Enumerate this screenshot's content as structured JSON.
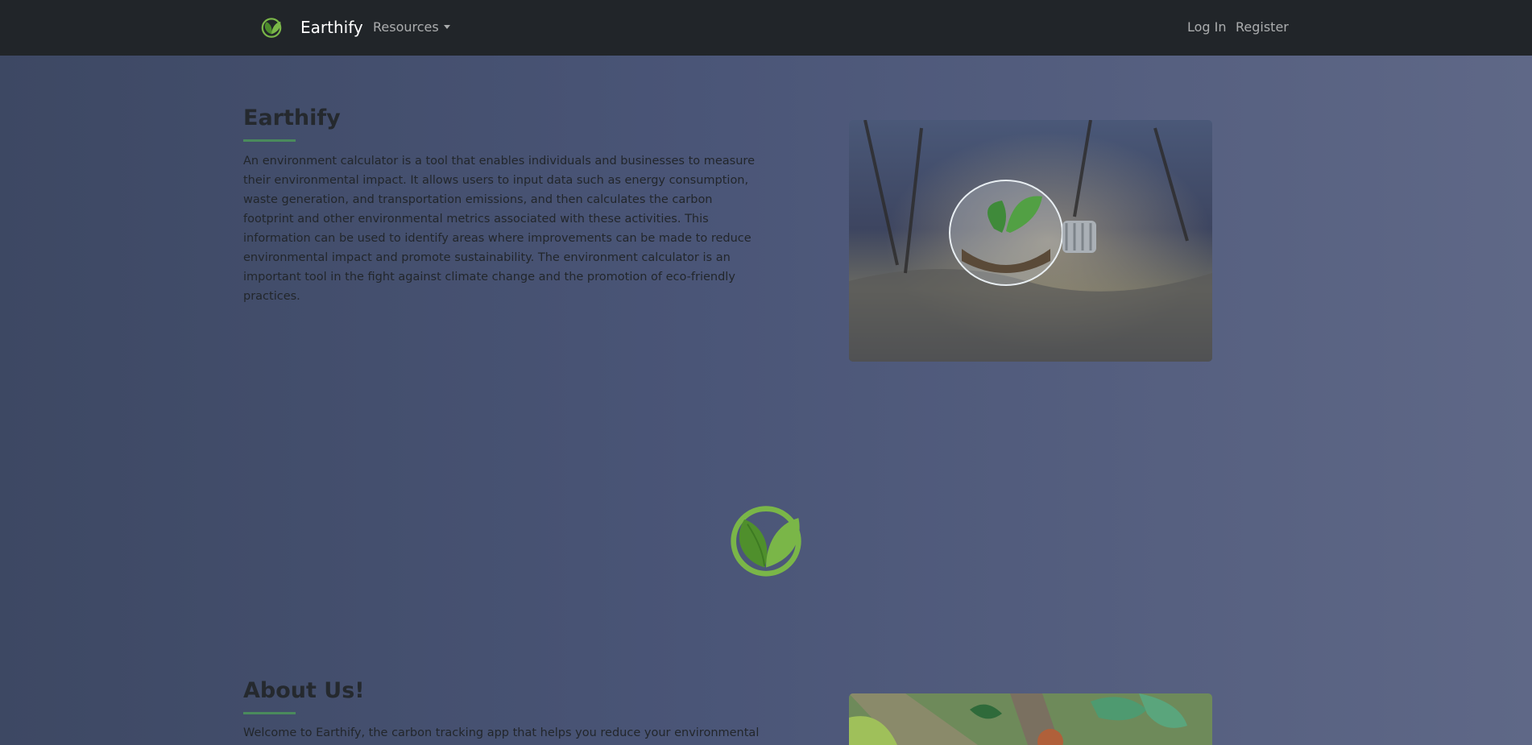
{
  "nav": {
    "brand": "Earthify",
    "logo_icon": "leaf-logo-icon",
    "resources": "Resources",
    "login": "Log In",
    "register": "Register"
  },
  "hero": {
    "title": "Earthify",
    "text": "An environment calculator is a tool that enables individuals and businesses to measure their environmental impact. It allows users to input data such as energy consumption, waste generation, and transportation emissions, and then calculates the carbon footprint and other environmental metrics associated with these activities. This information can be used to identify areas where improvements can be made to reduce environmental impact and promote sustainability. The environment calculator is an important tool in the fight against climate change and the promotion of eco-friendly practices."
  },
  "about": {
    "title": "About Us!",
    "text": "Welcome to Earthify, the carbon tracking app that helps you reduce your environmental"
  },
  "colors": {
    "navbar": "#212529",
    "accent_green": "#7ab648",
    "underline": "#4a8a5c"
  }
}
